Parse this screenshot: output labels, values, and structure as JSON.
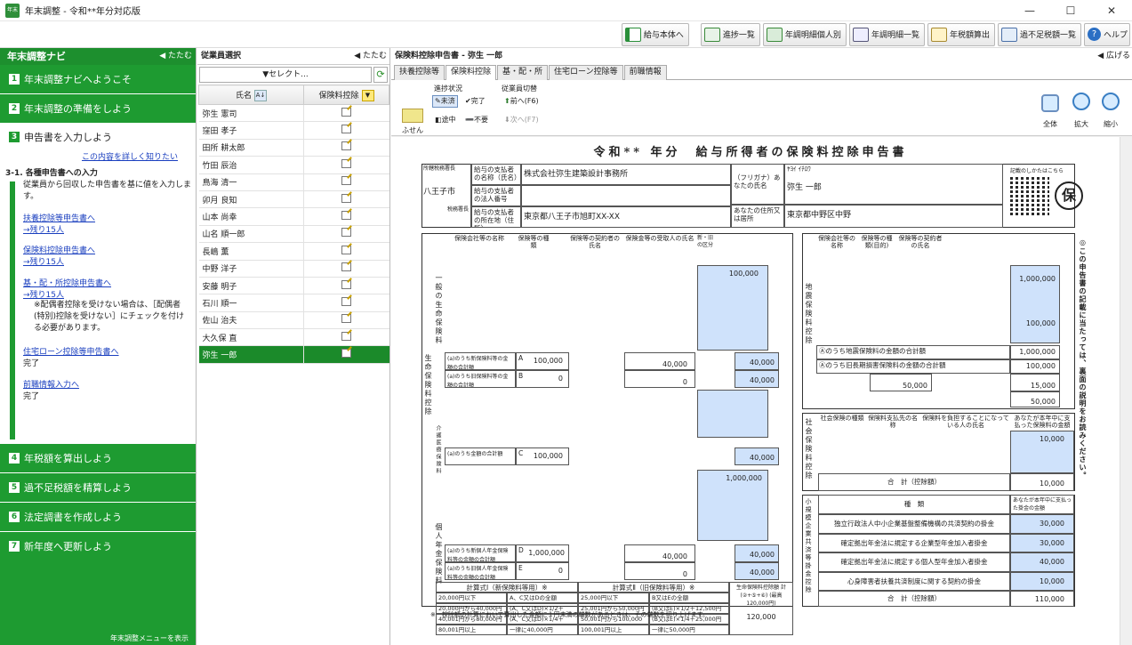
{
  "window": {
    "title": "年末調整 - 令和**年分対応版",
    "icon_text": "年末",
    "controls": [
      "—",
      "☐",
      "✕"
    ]
  },
  "toolbar": {
    "buttons": [
      {
        "label": "給与本体へ",
        "icon": "green-bar-icon"
      },
      {
        "label": "進捗一覧",
        "icon": "checklist-icon"
      },
      {
        "label": "年調明細個人別",
        "icon": "person-sheet-icon"
      },
      {
        "label": "年調明細一覧",
        "icon": "sheet-list-icon"
      },
      {
        "label": "年税額算出",
        "icon": "calculator-icon"
      },
      {
        "label": "過不足税額一覧",
        "icon": "tax-list-icon"
      },
      {
        "label": "ヘルプ",
        "icon": "help-icon"
      }
    ]
  },
  "nav": {
    "title": "年末調整ナビ",
    "collapse": "たたむ",
    "steps": [
      {
        "num": "1",
        "label": "年末調整ナビへようこそ"
      },
      {
        "num": "2",
        "label": "年末調整の準備をしよう"
      },
      {
        "num": "3",
        "label": "申告書を入力しよう"
      },
      {
        "num": "4",
        "label": "年税額を算出しよう"
      },
      {
        "num": "5",
        "label": "過不足税額を精算しよう"
      },
      {
        "num": "6",
        "label": "法定調書を作成しよう"
      },
      {
        "num": "7",
        "label": "新年度へ更新しよう"
      }
    ],
    "detail": {
      "more_link": "この内容を詳しく知りたい",
      "subtitle": "3-1. 各種申告書への入力",
      "description": "従業員から回収した申告書を基に値を入力します。",
      "links": [
        {
          "label": "扶養控除等申告書へ",
          "sub": "→残り15人"
        },
        {
          "label": "保険料控除申告書へ",
          "sub": "→残り15人"
        },
        {
          "label": "基・配・所控除申告書へ",
          "sub": "→残り15人"
        },
        {
          "label": "住宅ローン控除等申告書へ",
          "sub": "完了"
        },
        {
          "label": "前職情報入力へ",
          "sub": "完了"
        }
      ],
      "note": "※配偶者控除を受けない場合は、［配偶者(特別)控除を受けない］にチェックを付ける必要があります。"
    },
    "bottom_link": "年末調整メニューを表示"
  },
  "employees": {
    "title": "従業員選択",
    "collapse": "たたむ",
    "select_label": "▼セレクト...",
    "col_name": "氏名",
    "col_status": "保険料控除",
    "list": [
      "弥生 憲司",
      "窪田 孝子",
      "田所 耕太郎",
      "竹田 辰治",
      "鳥海 清一",
      "卯月 良知",
      "山本 尚幸",
      "山名 順一郎",
      "長嶋 薫",
      "中野 洋子",
      "安藤 明子",
      "石川 順一",
      "佐山 治夫",
      "大久保 直",
      "弥生 一郎"
    ],
    "selected_index": 14
  },
  "main": {
    "title": "保険料控除申告書 - 弥生 一郎",
    "expand": "広げる",
    "tabs": [
      "扶養控除等",
      "保険料控除",
      "基・配・所",
      "住宅ローン控除等",
      "前職情報"
    ],
    "active_tab": 1,
    "fusen": "ふせん",
    "progress_label": "進捗状況",
    "progress_buttons": [
      "未済",
      "完了",
      "途中",
      "不要"
    ],
    "switch_label": "従業員切替",
    "switch_buttons": [
      "前へ(F6)",
      "次へ(F7)"
    ],
    "view_buttons": [
      "全体",
      "拡大",
      "縮小"
    ]
  },
  "form": {
    "title": "令和** 年分　給与所得者の保険料控除申告書",
    "tax_office": "八王子市",
    "tax_office_label": "所轄税務署長",
    "tax_office_suffix": "税務署長",
    "payer_name_label": "給与の支払者の名称（氏名）",
    "payer_name": "株式会社弥生建築設計事務所",
    "payer_number_label": "給与の支払者の法人番号",
    "payer_addr_label": "給与の支払者の所在地（住所）",
    "payer_addr": "東京都八王子市旭町XX-XX",
    "furigana_label": "（フリガナ）あなたの氏名",
    "furigana": "ﾔﾖｲ ｲﾁﾛｳ",
    "emp_name": "弥生 一郎",
    "emp_addr_label": "あなたの住所又は居所",
    "emp_addr": "東京都中野区中野",
    "seal": "保",
    "seal_note": "記載のしかたはこちら",
    "life_section": "生命保険料控除",
    "life_group_general": "一般の生命保険料",
    "life_group_medical": "介護医療保険料",
    "life_group_pension": "個人年金保険料",
    "life_headers": [
      "保険会社等の名称",
      "保険等の種類",
      "保険期間又は年金支払期間",
      "保険等の契約者の氏名",
      "保険金等の受取人の氏名",
      "新・旧の区分",
      "あなたが本年中に支払った保険料等の金額（分配を受けた剰余金等の控除後の金額）"
    ],
    "life_amounts": {
      "general_new": "100,000",
      "A": "100,000",
      "B": "0",
      "calc1": "40,000",
      "calc2": "0",
      "total_general": "40,000",
      "general_final": "40,000",
      "C": "100,000",
      "medical_final": "40,000",
      "pension_new": "1,000,000",
      "D": "1,000,000",
      "E": "0",
      "pension_calc1": "40,000",
      "pension_calc2": "0",
      "pension_total": "40,000",
      "pension_final": "40,000",
      "life_deduction_total": "120,000"
    },
    "calc_table_title_new": "計算式Ⅰ（新保険料等用）※",
    "calc_table_title_old": "計算式Ⅱ（旧保険料等用）※",
    "calc_rows": [
      [
        "20,000円以下",
        "A、C又はDの全額",
        "25,000円以下",
        "B又はEの全額"
      ],
      [
        "20,000円から40,000円まで",
        "(A、C又はD)×1/2＋10,000円",
        "25,001円から50,000円まで",
        "(B又はE)×1/2＋12,500円"
      ],
      [
        "40,001円から80,000円まで",
        "(A、C又はD)×1/4＋20,000円",
        "50,001円から100,000円まで",
        "(B又はE)×1/4＋25,000円"
      ],
      [
        "80,001円以上",
        "一律に40,000円",
        "100,001円以上",
        "一律に50,000円"
      ]
    ],
    "life_limit_label": "生命保険料控除額 計(②+⑤+⑥) (最高120,000円)",
    "earthquake_section": "地震保険料控除",
    "earthquake_headers": [
      "保険会社等の名称",
      "保険等の種類(目的)",
      "保険期間",
      "保険等の契約者の氏名",
      "保険等の対象となった家屋等に居住又は家財を利用している人の氏名",
      "地震保険料又は旧長期損害保険料区分",
      "あなたが本年中に支払った保険料等の金額"
    ],
    "earthquake_amounts": {
      "quake": "1,000,000",
      "old_long": "100,000",
      "F": "1,000,000",
      "G": "100,000",
      "limit_quake": "50,000",
      "limit_old": "15,000",
      "total": "50,000"
    },
    "earthquake_lines": [
      "Ⓐのうち地震保険料の金額の合計額",
      "Ⓐのうち旧長期損害保険料の金額の合計額"
    ],
    "social_section": "社会保険料控除",
    "social_headers": [
      "社会保険の種類",
      "保険料支払先の名称",
      "保険料を負担することになっている人の氏名",
      "あなたが本年中に支払った保険料の金額"
    ],
    "social_amount": "10,000",
    "social_total": "10,000",
    "social_total_label": "合　計（控除額）",
    "small_section": "小規模企業共済等掛金控除",
    "small_header": "種　類",
    "small_header_amount": "あなたが本年中に支払った掛金の金額",
    "small_rows": [
      {
        "label": "独立行政法人中小企業基盤整備機構の共済契約の掛金",
        "amount": "30,000"
      },
      {
        "label": "確定拠出年金法に規定する企業型年金加入者掛金",
        "amount": "30,000"
      },
      {
        "label": "確定拠出年金法に規定する個人型年金加入者掛金",
        "amount": "40,000"
      },
      {
        "label": "心身障害者扶養共済制度に関する契約の掛金",
        "amount": "10,000"
      }
    ],
    "small_total": "110,000",
    "small_total_label": "合　計（控除額）",
    "side_note": "◎この申告書の記載に当たっては、裏面の説明をお読みください。",
    "footnote": "※　控除額の計算において算出した金額に１円未満の端数があるときは、その端数を切り上げます。"
  }
}
